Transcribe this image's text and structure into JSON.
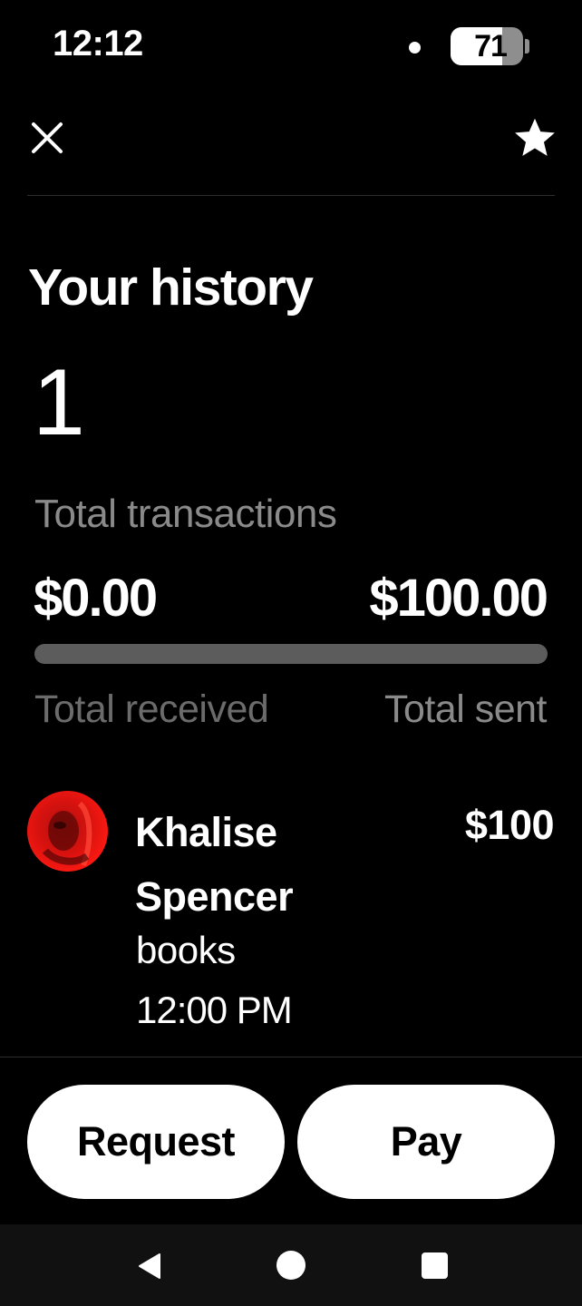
{
  "status_bar": {
    "time": "12:12",
    "battery_level": "71",
    "battery_fraction": 0.71,
    "icons": [
      "notification-dot-icon",
      "battery-icon"
    ]
  },
  "header": {
    "close_icon": "close-icon",
    "favorite_icon": "star-icon"
  },
  "summary": {
    "title": "Your history",
    "transaction_count": "1",
    "transaction_count_label": "Total transactions",
    "received_amount": "$0.00",
    "sent_amount": "$100.00",
    "received_label": "Total received",
    "sent_label": "Total sent",
    "received_share": 0.0
  },
  "transactions": [
    {
      "name": "Khalise Spencer",
      "amount": "$100",
      "note": "books",
      "time": "12:00 PM",
      "avatar_color": "#e0120f"
    }
  ],
  "actions": {
    "request_label": "Request",
    "pay_label": "Pay"
  },
  "nav_bar": {
    "icons": [
      "back-icon",
      "home-icon",
      "recents-icon"
    ]
  },
  "colors": {
    "background": "#000000",
    "text_primary": "#ffffff",
    "text_secondary": "#8a8a8a",
    "progress_track": "#5c5c5c",
    "button_background": "#ffffff",
    "button_text": "#000000"
  }
}
